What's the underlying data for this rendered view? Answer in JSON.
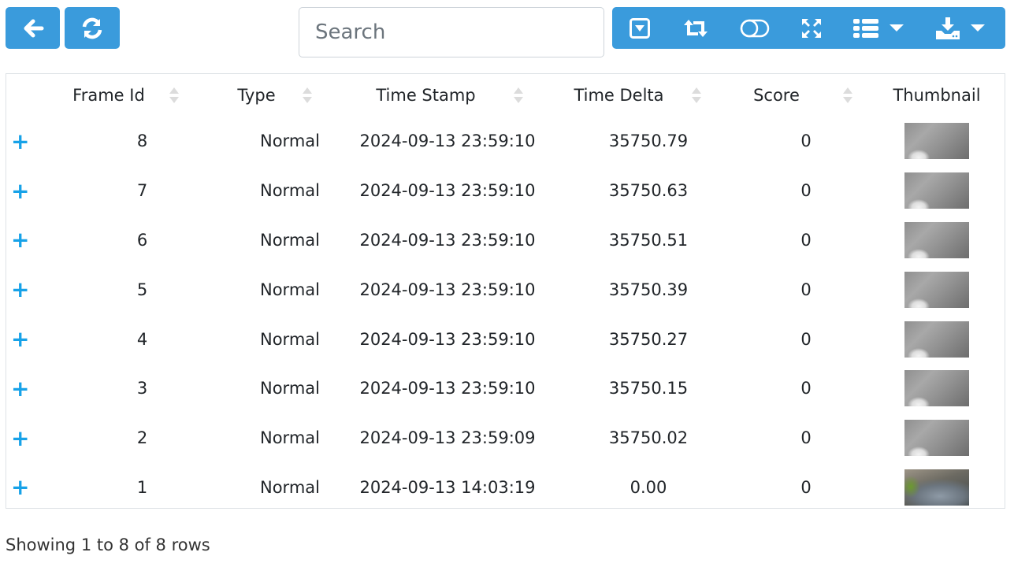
{
  "toolbar": {
    "back_icon": "arrow-left-icon",
    "refresh_icon": "refresh-icon",
    "search_placeholder": "Search",
    "search_value": "",
    "right_icons": [
      "toggle-details-icon",
      "toggle-view-icon",
      "columns-toggle-icon",
      "fullscreen-icon",
      "columns-list-icon",
      "export-icon"
    ]
  },
  "table": {
    "columns": [
      "",
      "Frame Id",
      "Type",
      "Time Stamp",
      "Time Delta",
      "Score",
      "Thumbnail"
    ],
    "rows": [
      {
        "expand": "+",
        "frame_id": "8",
        "type": "Normal",
        "time_stamp": "2024-09-13 23:59:10",
        "time_delta": "35750.79",
        "score": "0",
        "thumbnail": "gray"
      },
      {
        "expand": "+",
        "frame_id": "7",
        "type": "Normal",
        "time_stamp": "2024-09-13 23:59:10",
        "time_delta": "35750.63",
        "score": "0",
        "thumbnail": "gray"
      },
      {
        "expand": "+",
        "frame_id": "6",
        "type": "Normal",
        "time_stamp": "2024-09-13 23:59:10",
        "time_delta": "35750.51",
        "score": "0",
        "thumbnail": "gray"
      },
      {
        "expand": "+",
        "frame_id": "5",
        "type": "Normal",
        "time_stamp": "2024-09-13 23:59:10",
        "time_delta": "35750.39",
        "score": "0",
        "thumbnail": "gray"
      },
      {
        "expand": "+",
        "frame_id": "4",
        "type": "Normal",
        "time_stamp": "2024-09-13 23:59:10",
        "time_delta": "35750.27",
        "score": "0",
        "thumbnail": "gray"
      },
      {
        "expand": "+",
        "frame_id": "3",
        "type": "Normal",
        "time_stamp": "2024-09-13 23:59:10",
        "time_delta": "35750.15",
        "score": "0",
        "thumbnail": "gray"
      },
      {
        "expand": "+",
        "frame_id": "2",
        "type": "Normal",
        "time_stamp": "2024-09-13 23:59:09",
        "time_delta": "35750.02",
        "score": "0",
        "thumbnail": "gray"
      },
      {
        "expand": "+",
        "frame_id": "1",
        "type": "Normal",
        "time_stamp": "2024-09-13 14:03:19",
        "time_delta": "0.00",
        "score": "0",
        "thumbnail": "color"
      }
    ]
  },
  "footer": {
    "pagination_info": "Showing 1 to 8 of 8 rows"
  },
  "colors": {
    "accent": "#3a9bdc",
    "expand_icon": "#17a2e8"
  }
}
